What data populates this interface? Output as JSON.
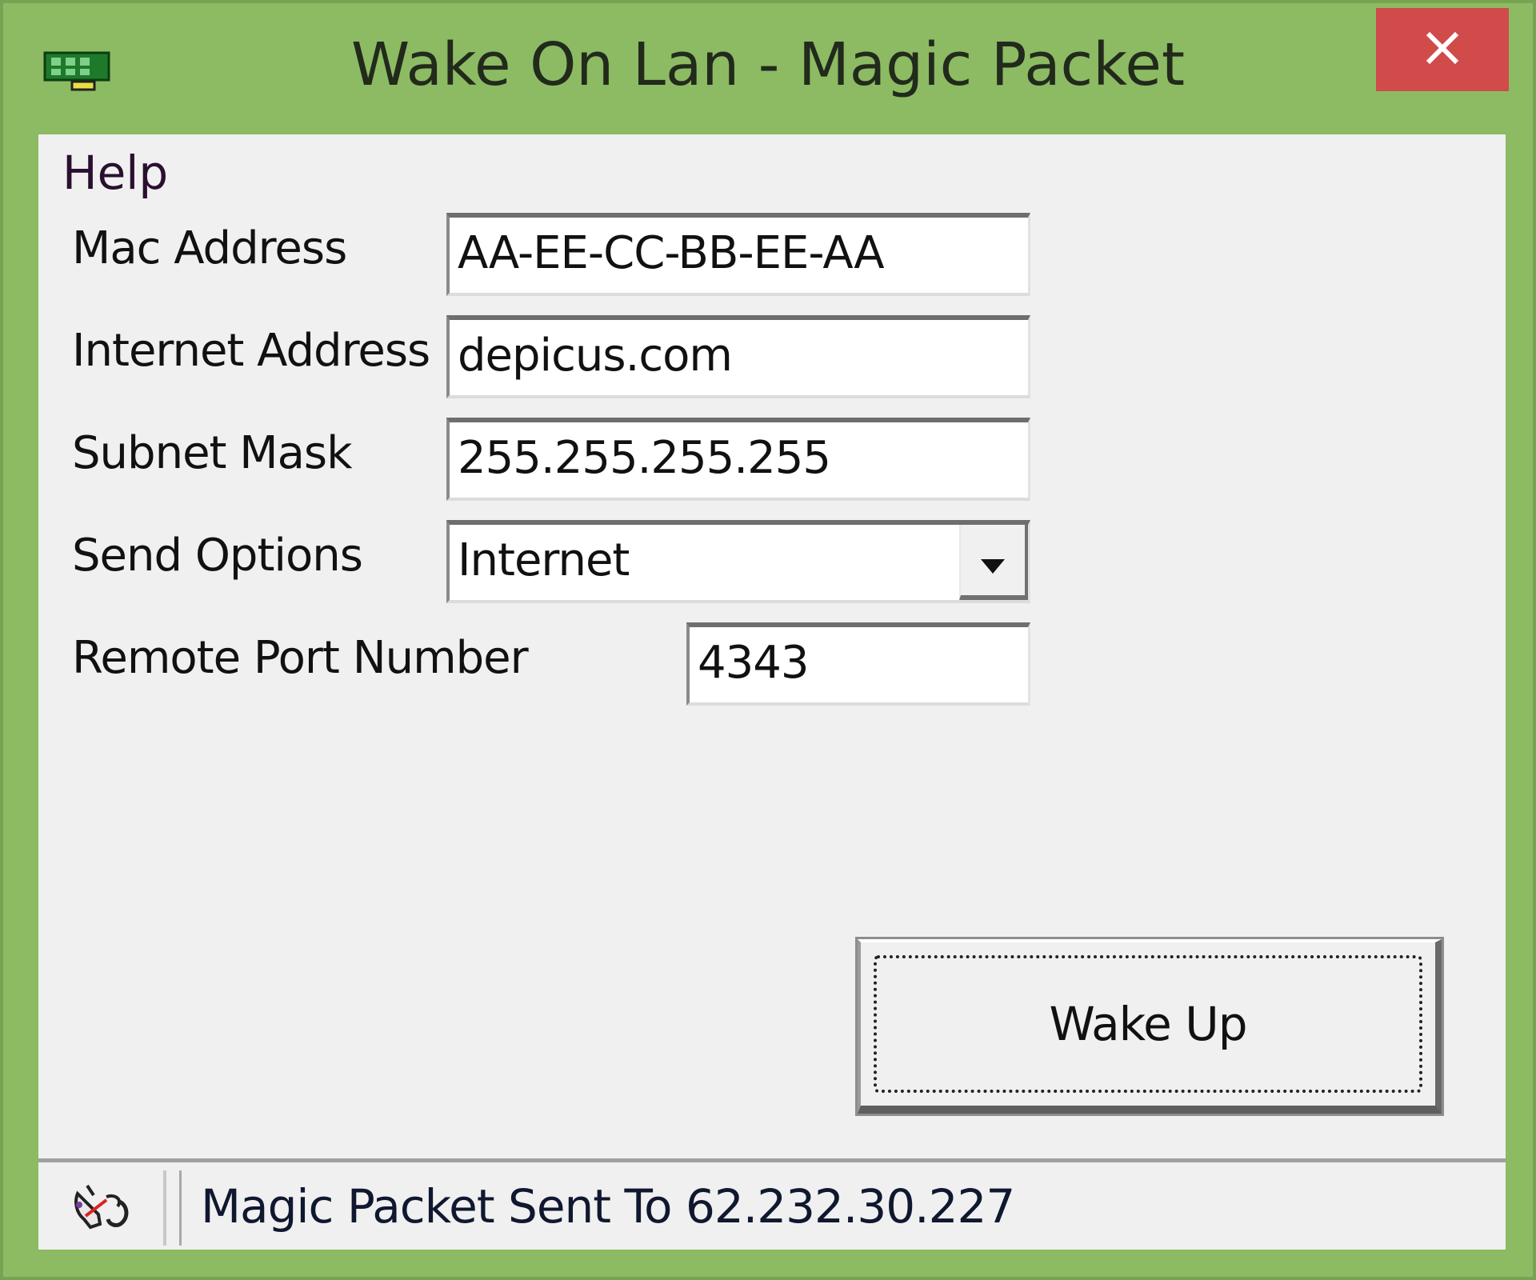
{
  "window": {
    "title": "Wake On Lan - Magic Packet",
    "app_icon": "network-card-icon",
    "close_icon": "close-icon",
    "frame_color": "#8cbb63",
    "close_color": "#d14b4b"
  },
  "menu": {
    "items": [
      {
        "label": "Help"
      }
    ]
  },
  "form": {
    "mac_address": {
      "label": "Mac Address",
      "value": "AA-EE-CC-BB-EE-AA"
    },
    "internet_address": {
      "label": "Internet Address",
      "value": "depicus.com"
    },
    "subnet_mask": {
      "label": "Subnet Mask",
      "value": "255.255.255.255"
    },
    "send_options": {
      "label": "Send Options",
      "selected": "Internet",
      "icon": "chevron-down-icon"
    },
    "remote_port": {
      "label": "Remote Port Number",
      "value": "4343"
    }
  },
  "actions": {
    "wake_up_label": "Wake Up"
  },
  "statusbar": {
    "icon": "status-plug-icon",
    "message": "Magic Packet Sent To 62.232.30.227"
  }
}
